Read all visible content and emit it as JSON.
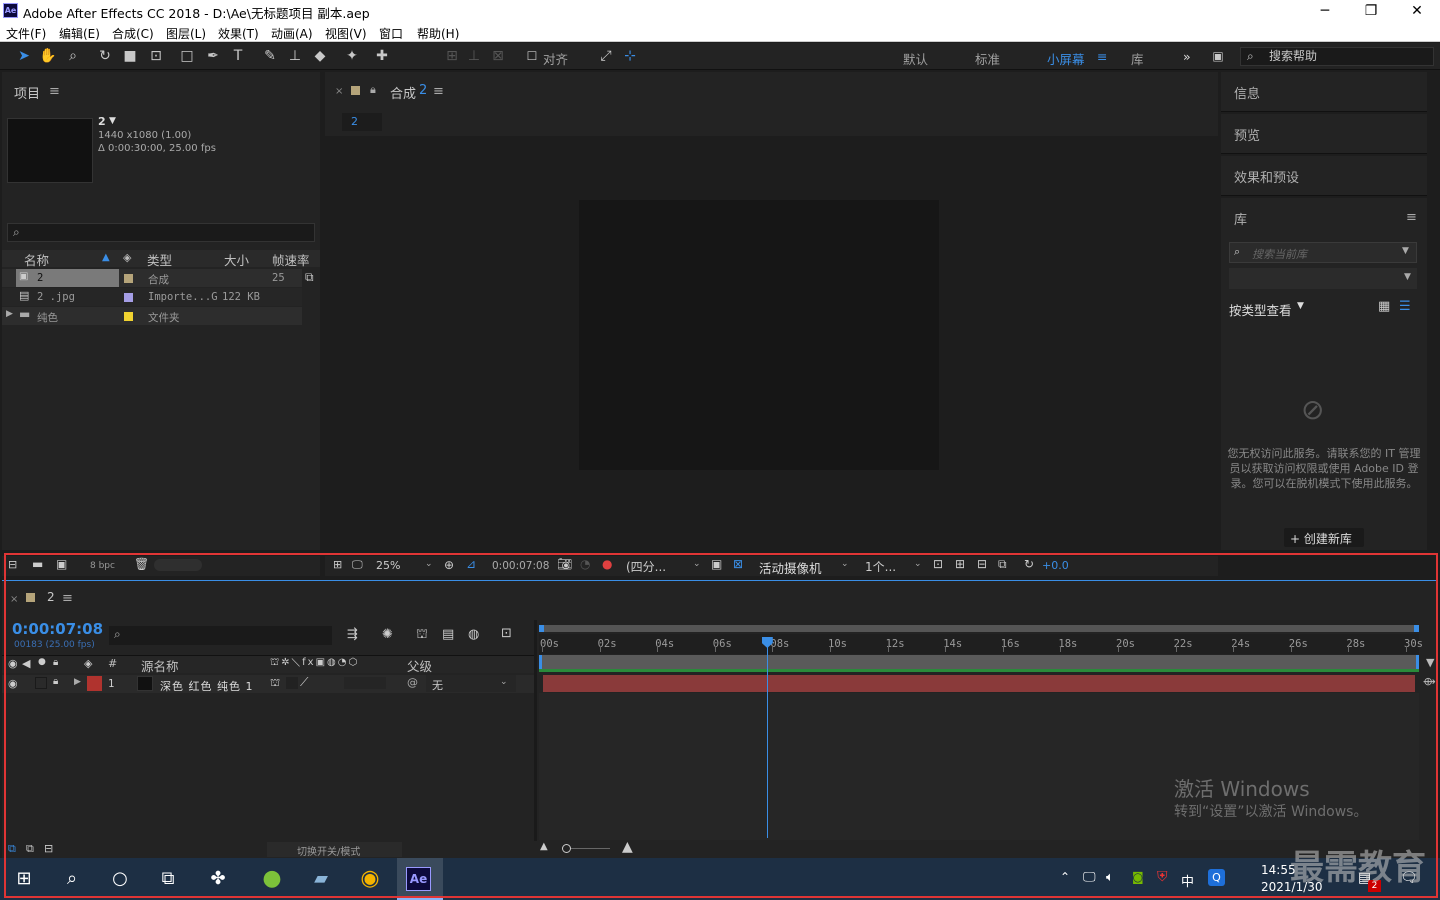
{
  "window": {
    "app_icon": "Ae",
    "title": "Adobe After Effects CC 2018 - D:\\Ae\\无标题项目 副本.aep",
    "controls": [
      "minimize-icon",
      "restore-icon",
      "close-icon"
    ]
  },
  "menu": [
    "文件(F)",
    "编辑(E)",
    "合成(C)",
    "图层(L)",
    "效果(T)",
    "动画(A)",
    "视图(V)",
    "窗口",
    "帮助(H)"
  ],
  "toolbar": {
    "snap_label": "对齐",
    "workspaces": [
      "默认",
      "标准",
      "小屏幕",
      "库"
    ],
    "active_workspace": "小屏幕",
    "more": "»",
    "help_search_placeholder": "搜索帮助"
  },
  "project_panel": {
    "title": "项目",
    "menu_icon": "≡",
    "item_name": "2",
    "item_res": "1440 x1080 (1.00)",
    "item_duration": "Δ 0:00:30:00, 25.00 fps",
    "search_icon": "⌕",
    "columns": [
      "名称",
      "类型",
      "大小",
      "帧速率"
    ],
    "rows": [
      {
        "name": "2",
        "type": "合成",
        "size": "",
        "fps": "25",
        "label_color": "#b5a47a",
        "icon": "comp-icon"
      },
      {
        "name": "2 .jpg",
        "type": "Importe...G",
        "size": "122 KB",
        "fps": "",
        "label_color": "#a59ee6",
        "icon": "file-icon"
      },
      {
        "name": "纯色",
        "type": "文件夹",
        "size": "",
        "fps": "",
        "label_color": "#f0d230",
        "icon": "folder-icon"
      }
    ],
    "bpc": "8 bpc"
  },
  "comp_panel": {
    "tab_label": "合成",
    "tab_name": "2",
    "breadcrumb": "2",
    "zoom": "25%",
    "timecode": "0:00:07:08",
    "resolution": "(四分...",
    "camera": "活动摄像机",
    "views": "1个...",
    "exposure": "+0.0"
  },
  "side_panels": {
    "info": "信息",
    "preview": "预览",
    "effects": "效果和预设",
    "library": "库",
    "library_search": "搜索当前库",
    "view_by": "按类型查看",
    "no_access_msg": "您无权访问此服务。请联系您的 IT 管理员以获取访问权限或使用 Adobe ID 登录。您可以在脱机模式下使用此服务。",
    "create_lib": "+ 创建新库"
  },
  "timeline": {
    "tab_name": "2",
    "timecode": "0:00:07:08",
    "frames": "00183 (25.00 fps)",
    "columns": {
      "source": "源名称",
      "num": "#",
      "parent": "父级"
    },
    "layer": {
      "index": "1",
      "name": "深色 红色 纯色 1",
      "parent": "无",
      "label_color": "#b0332e"
    },
    "ruler": [
      "00s",
      "02s",
      "04s",
      "06s",
      "08s",
      "10s",
      "12s",
      "14s",
      "16s",
      "18s",
      "20s",
      "22s",
      "24s",
      "26s",
      "28s",
      "30s"
    ],
    "switch_mode": "切换开关/模式",
    "playhead_time_sec": 7.32
  },
  "watermark": {
    "line1": "激活 Windows",
    "line2": "转到“设置”以激活 Windows。"
  },
  "brand_watermark": "最需教育",
  "taskbar": {
    "time": "14:55",
    "date": "2021/1/30",
    "ime": "中",
    "notif_count": "2"
  }
}
